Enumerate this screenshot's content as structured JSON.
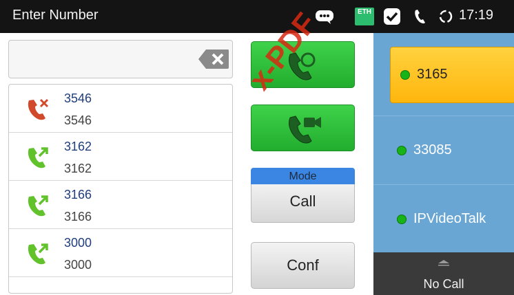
{
  "status_bar": {
    "title": "Enter Number",
    "clock": "17:19",
    "eth_label": "ETH",
    "icons": [
      "chat-bubble-icon",
      "ethernet-icon",
      "check-app-icon",
      "phone-icon",
      "sync-icon"
    ]
  },
  "input": {
    "value": "",
    "backspace_icon": "backspace-icon"
  },
  "call_history": [
    {
      "type": "missed",
      "name": "3546",
      "number": "3546",
      "icon": "missed-call-icon",
      "color": "#d24a2c"
    },
    {
      "type": "outgoing",
      "name": "3162",
      "number": "3162",
      "icon": "outgoing-call-icon",
      "color": "#62c22b"
    },
    {
      "type": "outgoing",
      "name": "3166",
      "number": "3166",
      "icon": "outgoing-call-icon",
      "color": "#62c22b"
    },
    {
      "type": "outgoing",
      "name": "3000",
      "number": "3000",
      "icon": "outgoing-call-icon",
      "color": "#62c22b"
    }
  ],
  "actions": {
    "audio_call_icon": "phone-call-icon",
    "video_call_icon": "video-call-icon",
    "mode_label": "Mode",
    "mode_value": "Call",
    "conf_label": "Conf"
  },
  "accounts": [
    {
      "label": "3165",
      "active": true,
      "status_color": "#17b317"
    },
    {
      "label": "33085",
      "active": false,
      "status_color": "#17b317"
    },
    {
      "label": "IPVideoTalk",
      "active": false,
      "status_color": "#17b317"
    }
  ],
  "call_status": {
    "label": "No Call",
    "arrow_icon": "expand-up-icon"
  },
  "watermark": "x-PDF",
  "colors": {
    "status_bar_bg": "#141414",
    "green_button": "#2fbf3b",
    "mode_blue": "#3b86e3",
    "accounts_bg": "#6aa6d4",
    "active_account": "#ffc425",
    "watermark": "#d82a12"
  }
}
